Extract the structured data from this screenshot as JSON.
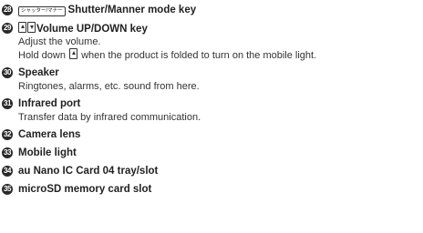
{
  "items": [
    {
      "number": "28",
      "key_glyph": "シャッター/マナー",
      "title": "Shutter/Manner mode key",
      "lines": []
    },
    {
      "number": "29",
      "title": "Volume UP/DOWN key",
      "lines": [
        "Adjust the volume."
      ],
      "line2_before": "Hold down",
      "line2_after": "when the product is folded to turn on the mobile light."
    },
    {
      "number": "30",
      "title": "Speaker",
      "lines": [
        "Ringtones, alarms, etc. sound from here."
      ]
    },
    {
      "number": "31",
      "title": "Infrared port",
      "lines": [
        "Transfer data by infrared communication."
      ]
    },
    {
      "number": "32",
      "title": "Camera lens",
      "lines": []
    },
    {
      "number": "33",
      "title": "Mobile light",
      "lines": []
    },
    {
      "number": "34",
      "title": "au Nano IC Card 04 tray/slot",
      "lines": []
    },
    {
      "number": "35",
      "title": "microSD memory card slot",
      "lines": []
    }
  ]
}
